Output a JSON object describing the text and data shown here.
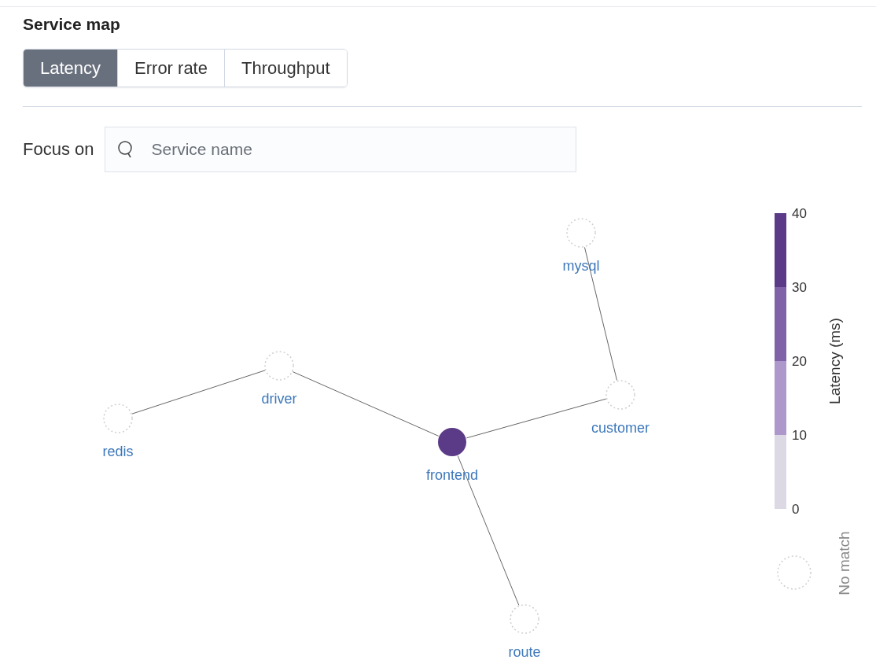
{
  "title": "Service map",
  "tabs": [
    {
      "label": "Latency",
      "selected": true
    },
    {
      "label": "Error rate",
      "selected": false
    },
    {
      "label": "Throughput",
      "selected": false
    }
  ],
  "focus": {
    "label": "Focus on",
    "placeholder": "Service name"
  },
  "graph": {
    "nodes": [
      {
        "name": "frontend",
        "matched": true,
        "color": "#5b3a87",
        "children": [
          {
            "name": "driver",
            "matched": false,
            "children": [
              {
                "name": "redis",
                "matched": false
              }
            ]
          },
          {
            "name": "customer",
            "matched": false,
            "children": [
              {
                "name": "mysql",
                "matched": false
              }
            ]
          },
          {
            "name": "route",
            "matched": false
          }
        ]
      }
    ]
  },
  "legend": {
    "title": "Latency (ms)",
    "ticks": [
      "40",
      "30",
      "20",
      "10",
      "0"
    ],
    "bands": [
      {
        "color": "#5b3a87"
      },
      {
        "color": "#7f62a8"
      },
      {
        "color": "#ae98cb"
      },
      {
        "color": "#dcd9e5"
      }
    ],
    "no_match_label": "No match"
  }
}
